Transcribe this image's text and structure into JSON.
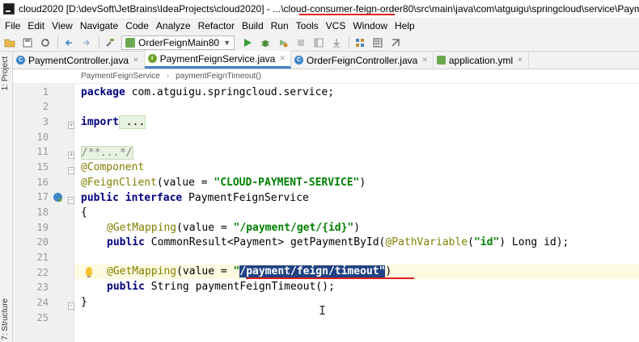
{
  "title_bar": {
    "text": "cloud2020 [D:\\devSoft\\JetBrains\\IdeaProjects\\cloud2020] - ...\\cloud-consumer-feign-order80\\src\\main\\java\\com\\atguigu\\springcloud\\service\\PaymentFeig",
    "app_icon": "intellij-icon"
  },
  "menu": [
    "File",
    "Edit",
    "View",
    "Navigate",
    "Code",
    "Analyze",
    "Refactor",
    "Build",
    "Run",
    "Tools",
    "VCS",
    "Window",
    "Help"
  ],
  "toolbar": {
    "run_config": "OrderFeignMain80",
    "icons": [
      "open-folder-icon",
      "save-icon",
      "sync-icon",
      "back-icon",
      "forward-icon",
      "build-icon",
      "run-icon",
      "debug-icon",
      "coverage-icon",
      "stop-icon",
      "layout-icon",
      "update-icon",
      "project-structure-icon",
      "database-icon",
      "git-icon"
    ]
  },
  "side_tabs": {
    "project": "1: Project",
    "structure": "7: Structure"
  },
  "tabs": [
    {
      "label": "PaymentController.java",
      "icon": "class-icon",
      "active": false
    },
    {
      "label": "PaymentFeignService.java",
      "icon": "interface-icon",
      "active": true
    },
    {
      "label": "OrderFeignController.java",
      "icon": "class-icon",
      "active": false
    },
    {
      "label": "application.yml",
      "icon": "yaml-icon",
      "active": false
    }
  ],
  "breadcrumb": {
    "item1": "PaymentFeignService",
    "item2": "paymentFeignTimeout()"
  },
  "line_numbers": [
    "1",
    "2",
    "3",
    "10",
    "11",
    "15",
    "16",
    "17",
    "18",
    "19",
    "20",
    "21",
    "22",
    "23",
    "24",
    "25"
  ],
  "code": {
    "l1_kw": "package",
    "l1_rest": " com.atguigu.springcloud.service;",
    "l3_kw": "import",
    "l3_rest": " ...",
    "l11": "/**...*/",
    "l15": "@Component",
    "l16_ann": "@FeignClient",
    "l16_a": "(value = ",
    "l16_str": "\"CLOUD-PAYMENT-SERVICE\"",
    "l16_b": ")",
    "l17_kw": "public interface",
    "l17_rest": " PaymentFeignService",
    "l18": "{",
    "l19_ann": "@GetMapping",
    "l19_a": "(value = ",
    "l19_str": "\"/payment/get/{id}\"",
    "l19_b": ")",
    "l20_kw": "public",
    "l20_a": " CommonResult<Payment> getPaymentById(",
    "l20_ann": "@PathVariable",
    "l20_b": "(",
    "l20_str": "\"id\"",
    "l20_c": ") Long id);",
    "l22_ann": "@GetMapping",
    "l22_a": "(value = ",
    "l22_q": "\"",
    "l22_sel": "/payment/feign/timeout\"",
    "l22_b": ")",
    "l23_kw": "public",
    "l23_rest": " String paymentFeignTimeout();",
    "l24": "}"
  },
  "colors": {
    "annotation": "#808000",
    "keyword": "#000080",
    "string": "#008000",
    "selection": "#214283",
    "highlight": "#e0201b"
  }
}
